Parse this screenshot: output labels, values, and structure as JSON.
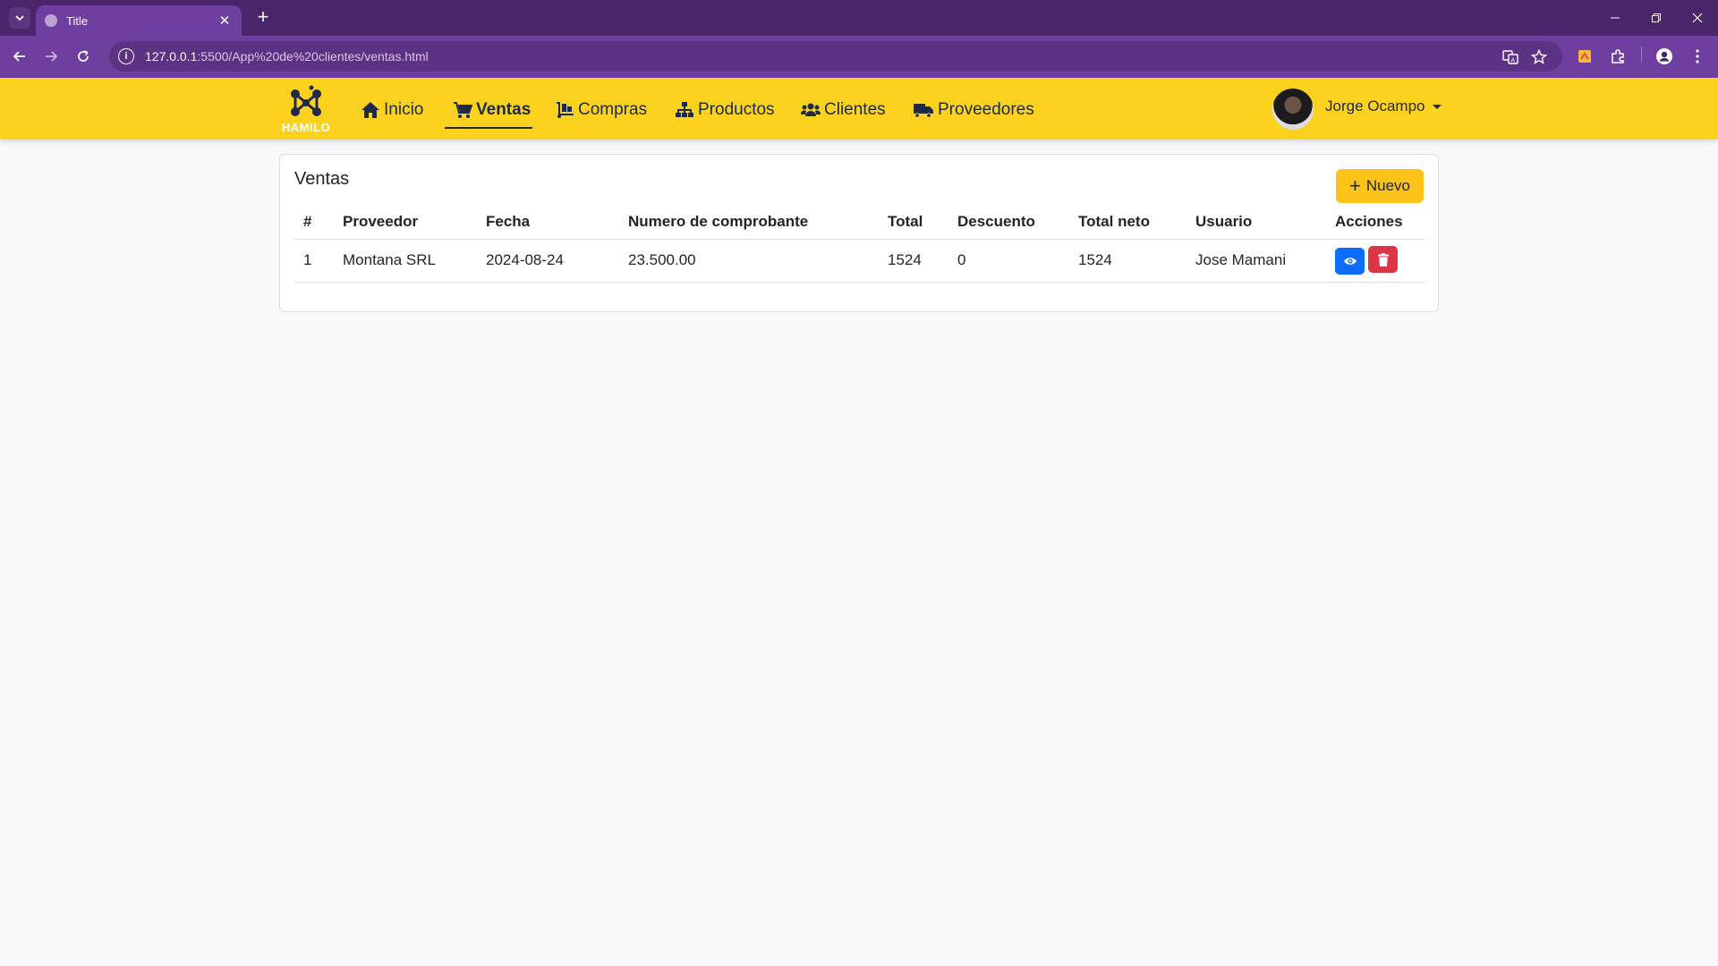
{
  "browser": {
    "tab_title": "Title",
    "url_host": "127.0.0.1",
    "url_path": ":5500/App%20de%20clientes/ventas.html"
  },
  "brand": {
    "logo_text": "HAMILO"
  },
  "nav": {
    "items": [
      {
        "label": "Inicio",
        "icon": "home-icon"
      },
      {
        "label": "Ventas",
        "icon": "cart-icon"
      },
      {
        "label": "Compras",
        "icon": "dolly-icon"
      },
      {
        "label": "Productos",
        "icon": "sitemap-icon"
      },
      {
        "label": "Clientes",
        "icon": "users-icon"
      },
      {
        "label": "Proveedores",
        "icon": "truck-icon"
      }
    ],
    "active": "Ventas",
    "user_name": "Jorge Ocampo"
  },
  "ventas": {
    "title": "Ventas",
    "new_button": "Nuevo",
    "columns": [
      "#",
      "Proveedor",
      "Fecha",
      "Numero de comprobante",
      "Total",
      "Descuento",
      "Total neto",
      "Usuario",
      "Acciones"
    ],
    "rows": [
      {
        "num": "1",
        "proveedor": "Montana SRL",
        "fecha": "2024-08-24",
        "comprobante": "23.500.00",
        "total": "1524",
        "descuento": "0",
        "total_neto": "1524",
        "usuario": "Jose Mamani"
      }
    ]
  },
  "colors": {
    "navbar": "#fdd21f",
    "browser_frame": "#4a2569",
    "primary": "#0d6efd",
    "danger": "#dc3545",
    "new_button": "#fcc419"
  }
}
